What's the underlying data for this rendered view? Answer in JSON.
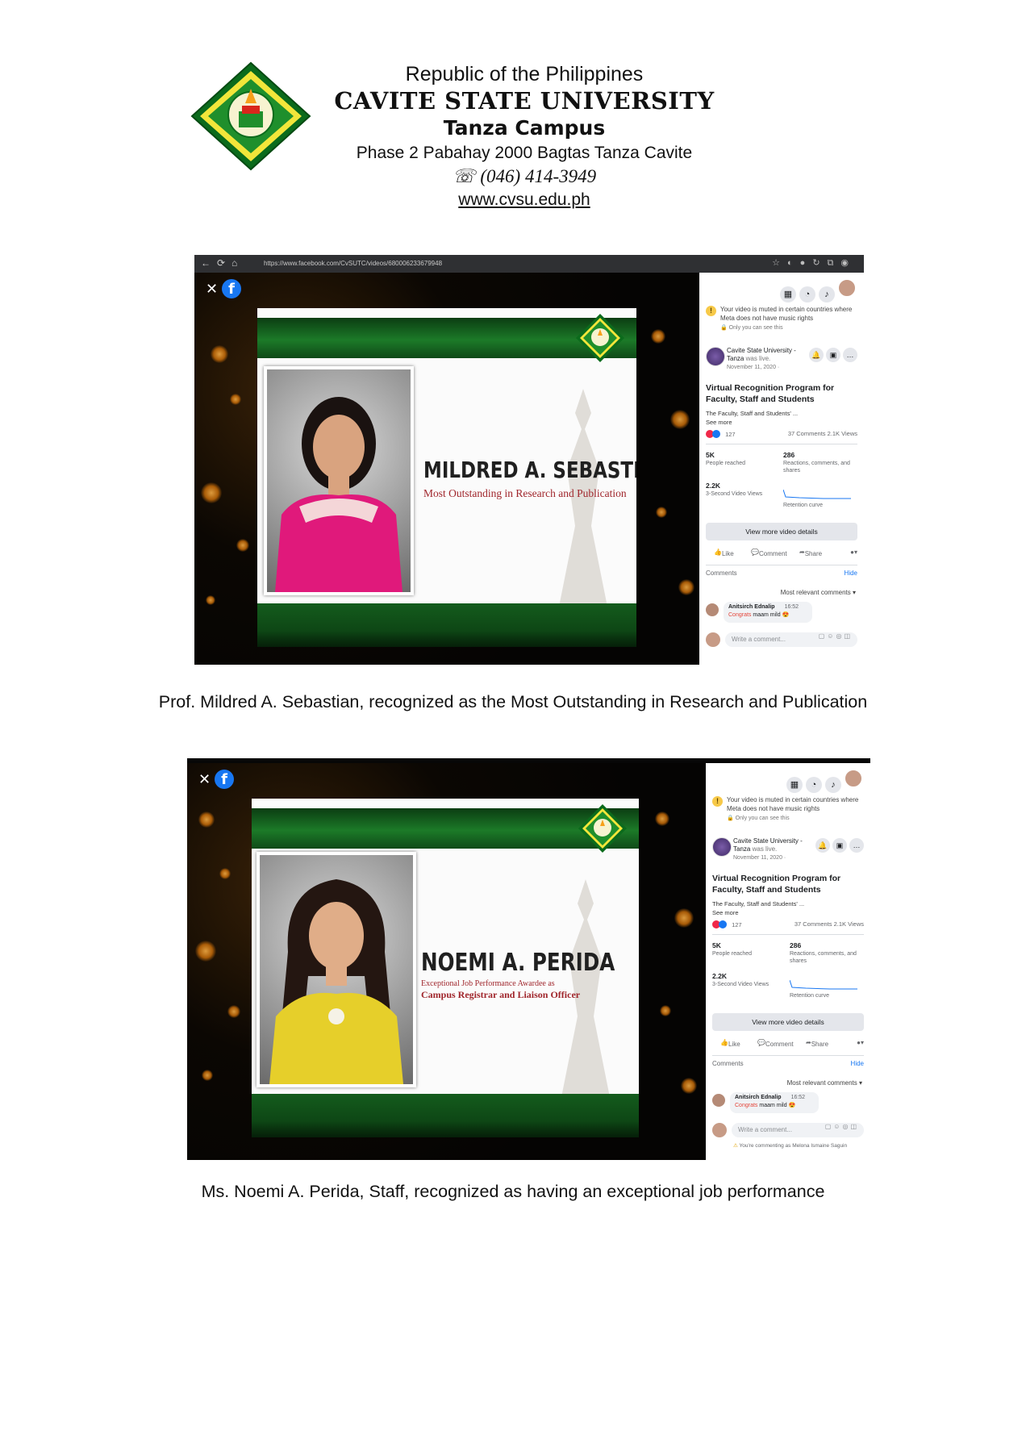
{
  "letterhead": {
    "line1": "Republic of the Philippines",
    "university": "CAVITE STATE UNIVERSITY",
    "campus": "Tanza Campus",
    "address": "Phase 2 Pabahay 2000 Bagtas Tanza Cavite",
    "phone": "(046) 414-3949",
    "website": "www.cvsu.edu.ph"
  },
  "screenshots": [
    {
      "url": "https://www.facebook.com/CvSUTC/videos/680006233679948",
      "slide": {
        "name": "MILDRED A. SEBASTIAN",
        "award": "Most Outstanding in Research and Publication"
      },
      "panel": {
        "mute_note": "Your video is muted in certain countries where Meta does not have music rights",
        "only_you": "Only you can see this",
        "page_name": "Cavite State University - Tanza",
        "was_live": "was live.",
        "date": "November 11, 2020 ·",
        "post_title": "Virtual Recognition Program for Faculty, Staff and Students",
        "snippet": "The Faculty, Staff and Students' ...",
        "see_more": "See more",
        "reaction_count": "127",
        "comments_views": "37 Comments  2.1K Views",
        "people_reached_val": "5K",
        "people_reached_label": "People reached",
        "interactions_val": "286",
        "interactions_label": "Reactions, comments, and shares",
        "views3s_val": "2.2K",
        "views3s_label": "3-Second Video Views",
        "retention_label": "Retention curve",
        "details_button": "View more video details",
        "like": "Like",
        "comment": "Comment",
        "share": "Share",
        "comments_label": "Comments",
        "hide": "Hide",
        "sort": "Most relevant comments",
        "commenter": "Anitsirch Ednalip",
        "comment_time": "16:52",
        "comment_hl": "Congrats",
        "comment_rest": "maam mild",
        "write_placeholder": "Write a comment...",
        "commenting_as": ""
      }
    },
    {
      "url": "",
      "slide": {
        "name": "NOEMI A. PERIDA",
        "award_line1": "Exceptional Job Performance Awardee as",
        "award_line2": "Campus Registrar and Liaison Officer"
      },
      "panel": {
        "mute_note": "Your video is muted in certain countries where Meta does not have music rights",
        "only_you": "Only you can see this",
        "page_name": "Cavite State University - Tanza",
        "was_live": "was live.",
        "date": "November 11, 2020 ·",
        "post_title": "Virtual Recognition Program for Faculty, Staff and Students",
        "snippet": "The Faculty, Staff and Students' ...",
        "see_more": "See more",
        "reaction_count": "127",
        "comments_views": "37 Comments  2.1K Views",
        "people_reached_val": "5K",
        "people_reached_label": "People reached",
        "interactions_val": "286",
        "interactions_label": "Reactions, comments, and shares",
        "views3s_val": "2.2K",
        "views3s_label": "3-Second Video Views",
        "retention_label": "Retention curve",
        "details_button": "View more video details",
        "like": "Like",
        "comment": "Comment",
        "share": "Share",
        "comments_label": "Comments",
        "hide": "Hide",
        "sort": "Most relevant comments",
        "commenter": "Anitsirch Ednalip",
        "comment_time": "16:52",
        "comment_hl": "Congrats",
        "comment_rest": "maam mild",
        "write_placeholder": "Write a comment...",
        "commenting_as": "You're commenting as Melona Ismaine Saguin"
      }
    }
  ],
  "captions": {
    "first": "Prof. Mildred A. Sebastian, recognized as the Most Outstanding in Research and Publication",
    "second": "Ms. Noemi A. Perida, Staff, recognized as having an exceptional job performance"
  },
  "colors": {
    "cvsu_green": "#1c7a28",
    "award_red": "#a0262c",
    "facebook_blue": "#1877f2"
  }
}
